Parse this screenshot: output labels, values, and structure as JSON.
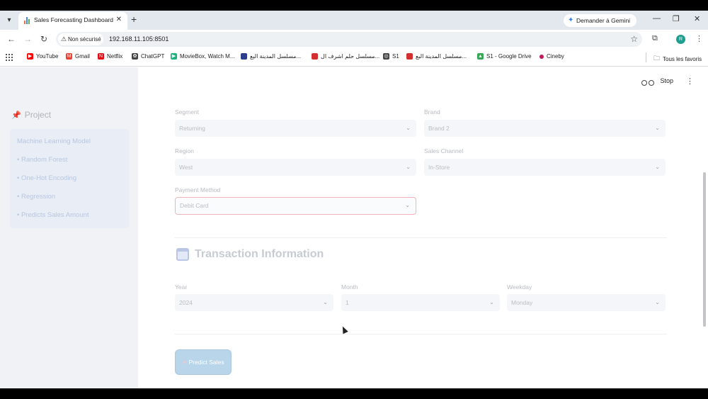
{
  "browser": {
    "tab_title": "Sales Forecasting Dashboard",
    "gemini_label": "Demander à Gemini",
    "security_label": "Non sécurisé",
    "url": "192.168.11.105:8501",
    "avatar_letter": "R",
    "bookmarks": [
      {
        "label": "YouTube",
        "color": "#ff0000"
      },
      {
        "label": "Gmail",
        "color": "#ea4335"
      },
      {
        "label": "Netflix",
        "color": "#e50914"
      },
      {
        "label": "ChatGPT",
        "color": "#444444"
      },
      {
        "label": "MovieBox, Watch M...",
        "color": "#19b37c"
      },
      {
        "label": "مسلسل المدينة البع...",
        "color": "#2c3e8c"
      },
      {
        "label": "مسلسل حلم اشرف ال...",
        "color": "#d32f2f"
      },
      {
        "label": "S1",
        "color": "#444444"
      },
      {
        "label": "مسلسل المدينة البع...",
        "color": "#d32f2f"
      },
      {
        "label": "S1 - Google Drive",
        "color": "#34a853"
      },
      {
        "label": "Cineby",
        "color": "#c2185b"
      }
    ],
    "all_bookmarks_label": "Tous les favoris"
  },
  "app": {
    "stop_label": "Stop",
    "sidebar": {
      "title": "Project",
      "lines": [
        "Machine Learning Model",
        "• Random Forest",
        "• One-Hot Encoding",
        "• Regression",
        "• Predicts Sales Amount"
      ]
    },
    "fields": {
      "segment": {
        "label": "Segment",
        "value": "Returning"
      },
      "brand": {
        "label": "Brand",
        "value": "Brand 2"
      },
      "region": {
        "label": "Region",
        "value": "West"
      },
      "sales_channel": {
        "label": "Sales Channel",
        "value": "In-Store"
      },
      "payment_method": {
        "label": "Payment Method",
        "value": "Debit Card"
      }
    },
    "transaction": {
      "title": "Transaction Information",
      "year": {
        "label": "Year",
        "value": "2024"
      },
      "month": {
        "label": "Month",
        "value": "1"
      },
      "weekday": {
        "label": "Weekday",
        "value": "Monday"
      }
    },
    "predict_label": "Predict Sales"
  }
}
